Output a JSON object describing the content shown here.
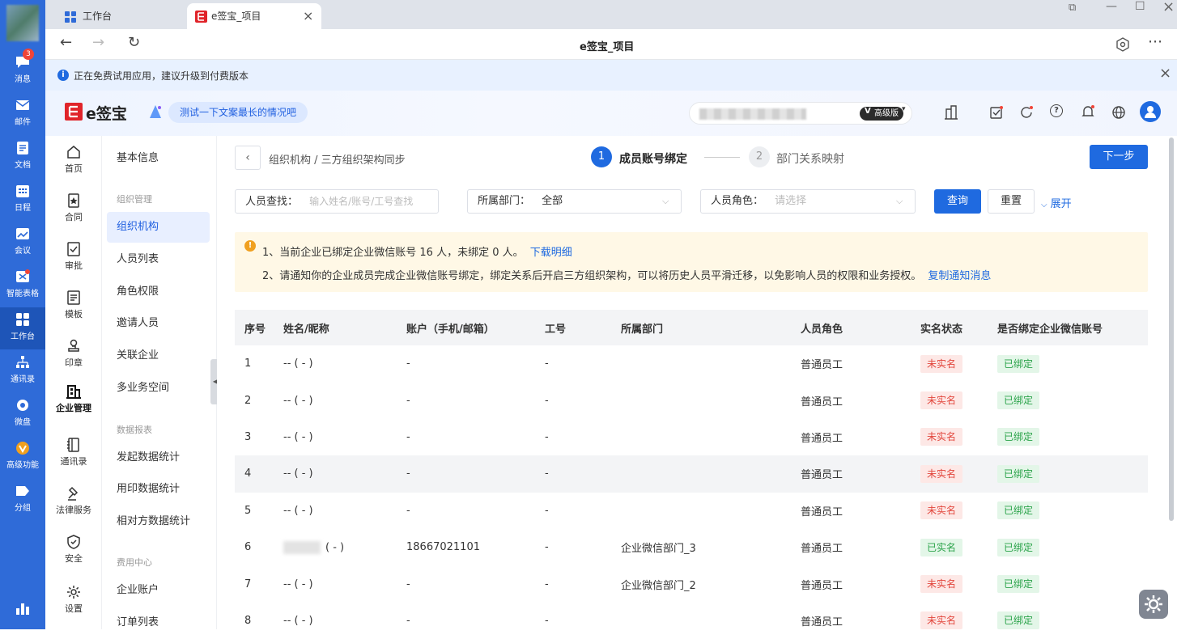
{
  "rail": {
    "items": [
      {
        "label": "消息",
        "badge": "3"
      },
      {
        "label": "邮件"
      },
      {
        "label": "文档"
      },
      {
        "label": "日程"
      },
      {
        "label": "会议"
      },
      {
        "label": "智能表格"
      },
      {
        "label": "工作台"
      },
      {
        "label": "通讯录"
      },
      {
        "label": "微盘"
      },
      {
        "label": "高级功能"
      },
      {
        "label": "分组"
      }
    ]
  },
  "browser": {
    "tabs": [
      "工作台",
      "e签宝_项目"
    ],
    "title": "e签宝_项目"
  },
  "notice": {
    "text": "正在免费试用应用，建议升级到付费版本"
  },
  "header": {
    "logo_text": "e签宝",
    "ai_prompt": "测试一下文案最长的情况吧",
    "version_badge": "高级版"
  },
  "menu1": [
    {
      "label": "首页"
    },
    {
      "label": "合同"
    },
    {
      "label": "审批"
    },
    {
      "label": "模板"
    },
    {
      "label": "印章"
    },
    {
      "label": "企业管理"
    },
    {
      "label": "通讯录"
    },
    {
      "label": "法律服务"
    },
    {
      "label": "安全"
    },
    {
      "label": "设置"
    }
  ],
  "menu2": {
    "base_info": "基本信息",
    "org_group": "组织管理",
    "org_items": [
      "组织机构",
      "人员列表",
      "角色权限",
      "邀请人员",
      "关联企业",
      "多业务空间"
    ],
    "report_group": "数据报表",
    "report_items": [
      "发起数据统计",
      "用印数据统计",
      "相对方数据统计"
    ],
    "fee_group": "费用中心",
    "fee_items": [
      "企业账户",
      "订单列表"
    ]
  },
  "breadcrumb": "组织机构 / 三方组织架构同步",
  "steps": [
    {
      "num": "1",
      "label": "成员账号绑定"
    },
    {
      "num": "2",
      "label": "部门关系映射"
    }
  ],
  "next_button": "下一步",
  "filters": {
    "person_label": "人员查找：",
    "person_placeholder": "输入姓名/账号/工号查找",
    "dept_label": "所属部门：",
    "dept_value": "全部",
    "role_label": "人员角色：",
    "role_placeholder": "请选择",
    "query": "查询",
    "reset": "重置",
    "expand": "展开"
  },
  "alert": {
    "line1": "1、当前企业已绑定企业微信账号 16 人，未绑定 0 人。",
    "line1_link": "下载明细",
    "line2": "2、请通知你的企业成员完成企业微信账号绑定，绑定关系后开启三方组织架构，可以将历史人员平滑迁移，以免影响人员的权限和业务授权。",
    "line2_link": "复制通知消息"
  },
  "table": {
    "headers": [
      "序号",
      "姓名/昵称",
      "账户（手机/邮箱）",
      "工号",
      "所属部门",
      "人员角色",
      "实名状态",
      "是否绑定企业微信账号"
    ],
    "rows": [
      {
        "no": "1",
        "name": "-- ( - )",
        "account": "-",
        "job": "-",
        "dept": "",
        "role": "普通员工",
        "verify": "未实名",
        "bind": "已绑定"
      },
      {
        "no": "2",
        "name": "-- ( - )",
        "account": "-",
        "job": "-",
        "dept": "",
        "role": "普通员工",
        "verify": "未实名",
        "bind": "已绑定"
      },
      {
        "no": "3",
        "name": "-- ( - )",
        "account": "-",
        "job": "-",
        "dept": "",
        "role": "普通员工",
        "verify": "未实名",
        "bind": "已绑定"
      },
      {
        "no": "4",
        "name": "-- ( - )",
        "account": "-",
        "job": "-",
        "dept": "",
        "role": "普通员工",
        "verify": "未实名",
        "bind": "已绑定"
      },
      {
        "no": "5",
        "name": "-- ( - )",
        "account": "-",
        "job": "-",
        "dept": "",
        "role": "普通员工",
        "verify": "未实名",
        "bind": "已绑定"
      },
      {
        "no": "6",
        "name": "( - )",
        "account": "18667021101",
        "job": "-",
        "dept": "企业微信部门_3",
        "role": "普通员工",
        "verify": "已实名",
        "bind": "已绑定"
      },
      {
        "no": "7",
        "name": "-- ( - )",
        "account": "-",
        "job": "-",
        "dept": "企业微信部门_2",
        "role": "普通员工",
        "verify": "未实名",
        "bind": "已绑定"
      },
      {
        "no": "8",
        "name": "-- ( - )",
        "account": "-",
        "job": "-",
        "dept": "",
        "role": "普通员工",
        "verify": "未实名",
        "bind": "已绑定"
      }
    ]
  },
  "colors": {
    "primary": "#1f6ae0",
    "rail": "#2f6bd8",
    "alert_bg": "#fff8e6",
    "danger": "#e2463c",
    "success": "#2ba34a"
  }
}
